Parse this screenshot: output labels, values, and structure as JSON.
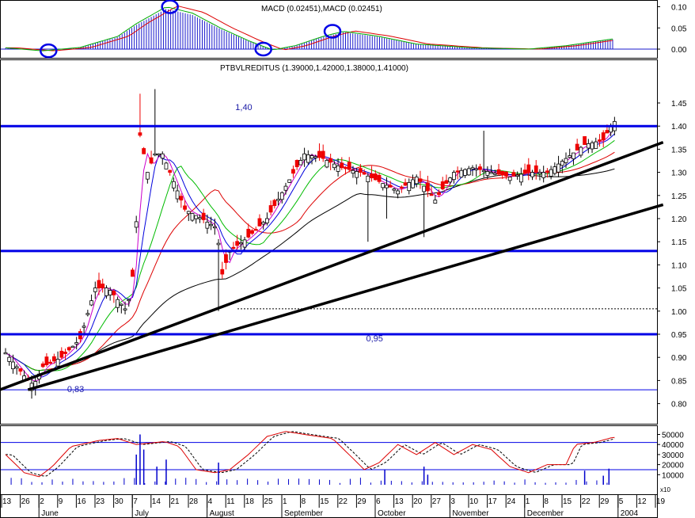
{
  "colors": {
    "background": "#ffffff",
    "support_line": "#0000e6",
    "trend_line": "#000000",
    "circle": "#0000e6",
    "bull_candle": "#ffffff",
    "bear_candle": "#ee0000",
    "ma_fast": "#cc00cc",
    "ma_mid1": "#0000dd",
    "ma_mid2": "#00bb00",
    "ma_slow": "#dd0000",
    "ma_long": "#000000",
    "stoch_k": "#dd0000",
    "stoch_d": "#000000",
    "volume": "#0000cc",
    "macd_hist": "#1a1acc",
    "macd_signal": "#00aa00",
    "macd_line": "#dd0000"
  },
  "macd_panel": {
    "title": "MACD (0.02451),MACD (0.02451)",
    "yticks": [
      "0.10",
      "0.05",
      "0.00"
    ],
    "ylim": [
      -0.01,
      0.11
    ]
  },
  "price_panel": {
    "title": "PTBVLREDITUS (1.39000,1.42000,1.38000,1.41000)",
    "yticks": [
      "1.45",
      "1.40",
      "1.35",
      "1.30",
      "1.25",
      "1.20",
      "1.15",
      "1.10",
      "1.05",
      "1.00",
      "0.95",
      "0.90",
      "0.85",
      "0.80"
    ],
    "ylim": [
      0.78,
      1.48
    ],
    "annotations": [
      {
        "text": "1,40",
        "x": 12.3,
        "y": 1.435
      },
      {
        "text": "0,95",
        "x": 19.3,
        "y": 0.935
      },
      {
        "text": "0,83",
        "x": 3.3,
        "y": 0.825
      }
    ],
    "support_levels": [
      1.4,
      1.13,
      0.95
    ],
    "thin_level": 0.83,
    "dotted_level": 1.005,
    "trend_lines": [
      {
        "start": [
          -2.3,
          0.8
        ],
        "end": [
          35.2,
          1.365
        ]
      },
      {
        "start": [
          1.2,
          0.83
        ],
        "end": [
          35.2,
          1.23
        ]
      }
    ]
  },
  "osc_panel": {
    "yticks": [
      "50000",
      "40000",
      "30000",
      "20000",
      "10000"
    ],
    "ylim": [
      0,
      55000
    ],
    "unit_label": "x10",
    "h_levels": [
      42000,
      15000
    ]
  },
  "x_axis": {
    "day_labels": [
      "13",
      "26",
      "2",
      "9",
      "16",
      "23",
      "30",
      "7",
      "14",
      "21",
      "28",
      "4",
      "11",
      "18",
      "25",
      "1",
      "8",
      "15",
      "22",
      "29",
      "6",
      "13",
      "20",
      "27",
      "3",
      "10",
      "17",
      "24",
      "1",
      "8",
      "15",
      "22",
      "29",
      "5",
      "12",
      "19"
    ],
    "month_labels": [
      {
        "text": "June",
        "index": 2
      },
      {
        "text": "July",
        "index": 7
      },
      {
        "text": "August",
        "index": 11
      },
      {
        "text": "September",
        "index": 15
      },
      {
        "text": "October",
        "index": 20
      },
      {
        "text": "November",
        "index": 24
      },
      {
        "text": "December",
        "index": 28
      },
      {
        "text": "2004",
        "index": 33
      }
    ]
  },
  "chart_data": {
    "type": "candlestick",
    "symbol": "PTBVLREDITUS",
    "last_ohlc": {
      "open": 1.39,
      "high": 1.42,
      "low": 1.38,
      "close": 1.41
    },
    "x": [
      "13",
      "26",
      "2",
      "9",
      "16",
      "23",
      "30",
      "7",
      "14",
      "21",
      "28",
      "4",
      "11",
      "18",
      "25",
      "1",
      "8",
      "15",
      "22",
      "29",
      "6",
      "13",
      "20",
      "27",
      "3",
      "10",
      "17",
      "24",
      "1",
      "8",
      "15",
      "22",
      "29",
      "5",
      "12",
      "19"
    ],
    "anchors": [
      {
        "x": 0,
        "y": 0.91
      },
      {
        "x": 1,
        "y": 0.86
      },
      {
        "x": 1.5,
        "y": 0.84
      },
      {
        "x": 2,
        "y": 0.88
      },
      {
        "x": 3,
        "y": 0.9
      },
      {
        "x": 4,
        "y": 0.94
      },
      {
        "x": 4.8,
        "y": 1.05
      },
      {
        "x": 5.5,
        "y": 1.05
      },
      {
        "x": 6.5,
        "y": 1.0
      },
      {
        "x": 6.9,
        "y": 1.1
      },
      {
        "x": 7.2,
        "y": 1.38
      },
      {
        "x": 7.6,
        "y": 1.3
      },
      {
        "x": 8,
        "y": 1.34
      },
      {
        "x": 8.4,
        "y": 1.34
      },
      {
        "x": 9,
        "y": 1.28
      },
      {
        "x": 9.6,
        "y": 1.22
      },
      {
        "x": 10.5,
        "y": 1.2
      },
      {
        "x": 11.3,
        "y": 1.18
      },
      {
        "x": 11.6,
        "y": 1.08
      },
      {
        "x": 12,
        "y": 1.13
      },
      {
        "x": 13,
        "y": 1.16
      },
      {
        "x": 14,
        "y": 1.2
      },
      {
        "x": 15,
        "y": 1.27
      },
      {
        "x": 16,
        "y": 1.34
      },
      {
        "x": 17,
        "y": 1.33
      },
      {
        "x": 18,
        "y": 1.31
      },
      {
        "x": 19,
        "y": 1.3
      },
      {
        "x": 20,
        "y": 1.28
      },
      {
        "x": 21,
        "y": 1.26
      },
      {
        "x": 22,
        "y": 1.29
      },
      {
        "x": 23,
        "y": 1.24
      },
      {
        "x": 24,
        "y": 1.3
      },
      {
        "x": 25,
        "y": 1.31
      },
      {
        "x": 26,
        "y": 1.3
      },
      {
        "x": 27,
        "y": 1.29
      },
      {
        "x": 28,
        "y": 1.3
      },
      {
        "x": 29,
        "y": 1.3
      },
      {
        "x": 30,
        "y": 1.33
      },
      {
        "x": 31,
        "y": 1.36
      },
      {
        "x": 32,
        "y": 1.37
      },
      {
        "x": 32.4,
        "y": 1.4
      }
    ],
    "spikes": [
      {
        "x": 7.2,
        "high": 1.47
      },
      {
        "x": 8.1,
        "high": 1.48
      },
      {
        "x": 11.4,
        "low": 1.0
      },
      {
        "x": 19.4,
        "low": 1.15
      },
      {
        "x": 22.3,
        "low": 1.16
      },
      {
        "x": 25.6,
        "high": 1.39
      },
      {
        "x": 20.3,
        "low": 1.2
      }
    ],
    "macd_anchors": [
      {
        "x": 0,
        "y": 0.003
      },
      {
        "x": 2,
        "y": -0.004
      },
      {
        "x": 4,
        "y": 0.004
      },
      {
        "x": 6,
        "y": 0.03
      },
      {
        "x": 7,
        "y": 0.06
      },
      {
        "x": 8.6,
        "y": 0.1
      },
      {
        "x": 10,
        "y": 0.085
      },
      {
        "x": 11.5,
        "y": 0.05
      },
      {
        "x": 13,
        "y": 0.02
      },
      {
        "x": 14.3,
        "y": -0.002
      },
      {
        "x": 15.5,
        "y": 0.008
      },
      {
        "x": 17,
        "y": 0.03
      },
      {
        "x": 18.1,
        "y": 0.042
      },
      {
        "x": 20,
        "y": 0.03
      },
      {
        "x": 22,
        "y": 0.012
      },
      {
        "x": 25,
        "y": 0.003
      },
      {
        "x": 28,
        "y": 0.0
      },
      {
        "x": 30,
        "y": 0.008
      },
      {
        "x": 32.5,
        "y": 0.024
      }
    ],
    "macd_circles": [
      {
        "x": 2.3,
        "y": -0.004
      },
      {
        "x": 8.8,
        "y": 0.1
      },
      {
        "x": 13.8,
        "y": 0.0
      },
      {
        "x": 17.5,
        "y": 0.042
      }
    ],
    "stoch_anchors": [
      {
        "x": 0,
        "y": 30000
      },
      {
        "x": 1,
        "y": 12000
      },
      {
        "x": 1.8,
        "y": 8000
      },
      {
        "x": 2.5,
        "y": 18000
      },
      {
        "x": 3.5,
        "y": 38000
      },
      {
        "x": 5,
        "y": 44000
      },
      {
        "x": 6,
        "y": 46000
      },
      {
        "x": 7,
        "y": 40000
      },
      {
        "x": 8.5,
        "y": 43000
      },
      {
        "x": 9.3,
        "y": 38000
      },
      {
        "x": 10.2,
        "y": 15000
      },
      {
        "x": 11.2,
        "y": 12000
      },
      {
        "x": 12,
        "y": 15000
      },
      {
        "x": 13,
        "y": 30000
      },
      {
        "x": 14,
        "y": 48000
      },
      {
        "x": 15,
        "y": 53000
      },
      {
        "x": 16,
        "y": 50000
      },
      {
        "x": 17.5,
        "y": 46000
      },
      {
        "x": 18.5,
        "y": 28000
      },
      {
        "x": 19.2,
        "y": 15000
      },
      {
        "x": 20,
        "y": 22000
      },
      {
        "x": 21,
        "y": 40000
      },
      {
        "x": 22,
        "y": 30000
      },
      {
        "x": 23,
        "y": 42000
      },
      {
        "x": 24,
        "y": 30000
      },
      {
        "x": 25,
        "y": 40000
      },
      {
        "x": 26,
        "y": 35000
      },
      {
        "x": 27,
        "y": 18000
      },
      {
        "x": 28,
        "y": 12000
      },
      {
        "x": 29,
        "y": 20000
      },
      {
        "x": 30,
        "y": 20000
      },
      {
        "x": 30.5,
        "y": 40000
      },
      {
        "x": 31.5,
        "y": 42000
      },
      {
        "x": 32.5,
        "y": 47000
      }
    ],
    "volume_bars": [
      {
        "x": 7,
        "v": 30000
      },
      {
        "x": 7.2,
        "v": 50000
      },
      {
        "x": 7.4,
        "v": 35000
      },
      {
        "x": 8.1,
        "v": 18000
      },
      {
        "x": 8.6,
        "v": 25000
      },
      {
        "x": 11.4,
        "v": 22000
      },
      {
        "x": 20.3,
        "v": 15000
      },
      {
        "x": 22.4,
        "v": 18000
      },
      {
        "x": 22.6,
        "v": 10000
      },
      {
        "x": 31,
        "v": 14000
      },
      {
        "x": 32,
        "v": 9000
      },
      {
        "x": 32.3,
        "v": 16000
      }
    ]
  }
}
